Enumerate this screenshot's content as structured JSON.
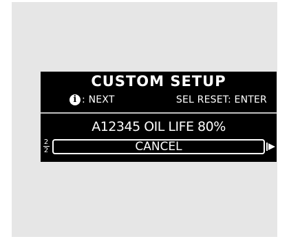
{
  "display": {
    "title": "CUSTOM SETUP",
    "hint_left": ": NEXT",
    "hint_right": "SEL RESET: ENTER",
    "info_icon": "info-icon",
    "item_text": "A12345 OIL LIFE 80%",
    "page_current": "2",
    "page_total": "2",
    "selected_option": "CANCEL",
    "arrow_icon": "right-arrow-icon"
  }
}
